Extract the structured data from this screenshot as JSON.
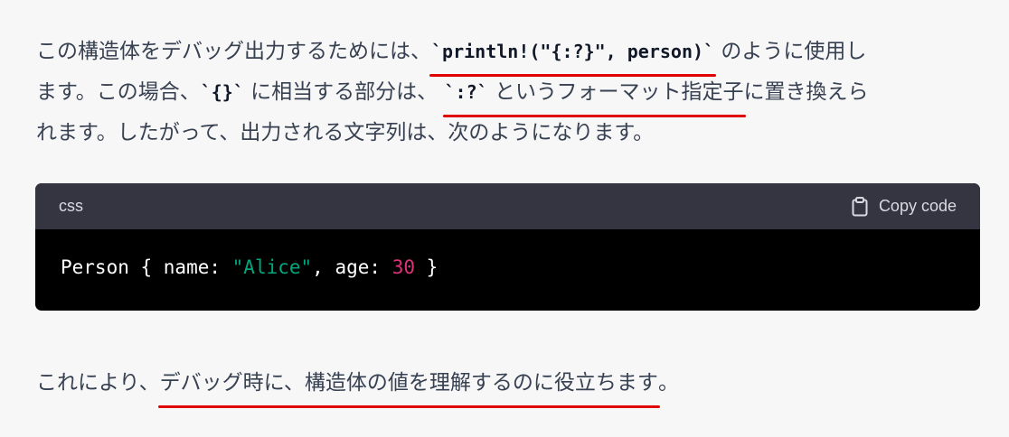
{
  "paragraph1": {
    "line1_a": "この構造体をデバッグ出力するためには、",
    "line1_code": "`println!(\"{:?}\", person)`",
    "line1_b": " のように使用し",
    "line2_a": "ます。この場合、",
    "line2_code1": "`{}`",
    "line2_b": " に相当する部分は、 ",
    "line2_code2": "`:?`",
    "line2_c": " というフォーマット指定子",
    "line2_d": "に置き換えら",
    "line3": "れます。したがって、出力される文字列は、次のようになります。"
  },
  "code_block": {
    "language": "css",
    "copy_label": "Copy code",
    "copy_icon": "clipboard-icon",
    "tokens": {
      "t1": "Person { name: ",
      "t2": "\"Alice\"",
      "t3": ", age: ",
      "t4": "30",
      "t5": " }"
    }
  },
  "paragraph2": {
    "a": "これにより、",
    "b": "デバッグ時に、構造体の値を理解するのに役立ちます",
    "c": "。"
  },
  "colors": {
    "annotation_underline": "#e00000",
    "code_header_bg": "#343541",
    "code_body_bg": "#000000",
    "string_token": "#00a67d",
    "number_token": "#df3079"
  }
}
